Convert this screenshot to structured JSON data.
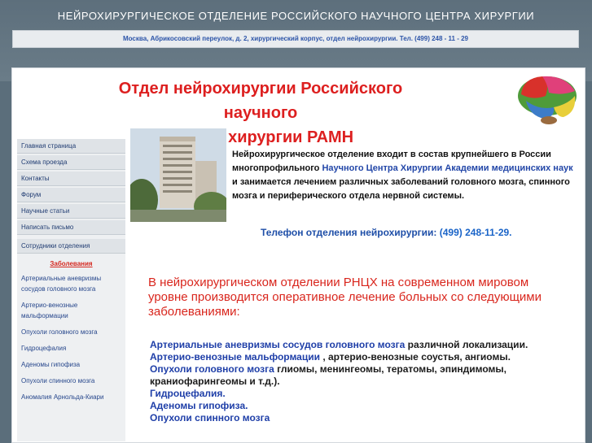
{
  "header": {
    "site_title": "НЕЙРОХИРУРГИЧЕСКОЕ ОТДЕЛЕНИЕ РОССИЙСКОГО НАУЧНОГО ЦЕНТРА ХИРУРГИИ",
    "address": "Москва, Абрикосовский переулок, д. 2, хирургический корпус, отдел нейрохирургии. Тел. (499) 248 - 11 - 29",
    "page_title_line1": "Отдел нейрохирургии Российского научного",
    "page_title_line2": "центра хирургии РАМН"
  },
  "sidebar": {
    "items": [
      {
        "label": "Главная страница"
      },
      {
        "label": "Схема проезда"
      },
      {
        "label": "Контакты"
      },
      {
        "label": "Форум"
      },
      {
        "label": "Научные статьи"
      },
      {
        "label": "Написать письмо"
      }
    ],
    "staff_label": "Сотрудники отделения",
    "diseases_title": "Заболевания",
    "diseases": [
      {
        "label": "Артериальные аневризмы сосудов головного мозга"
      },
      {
        "label": "Артерио-венозные мальформации"
      },
      {
        "label": "Опухоли головного мозга"
      },
      {
        "label": "Гидроцефалия"
      },
      {
        "label": "Аденомы гипофиза"
      },
      {
        "label": "Опухоли спинного мозга"
      },
      {
        "label": "Аномалия Арнольда-Киари"
      }
    ]
  },
  "intro": {
    "text_before": "Нейрохирургическое отделение входит в состав крупнейшего в России многопрофильного ",
    "link_text": "Научного Центра Хирургии Академии медицинских наук",
    "text_after": " и занимается лечением различных заболеваний головного мозга, спинного мозга и периферического отдела нервной системы."
  },
  "phone": {
    "label": "Телефон отделения нейрохирургии:",
    "number": "(499) 248-11-29."
  },
  "lead": "В нейрохирургическом отделении РНЦХ на современном мировом уровне производится оперативное лечение больных со следующими заболеваниями:",
  "disease_list": [
    {
      "name": "Артериальные аневризмы сосудов головного мозга",
      "desc": "различной локализации."
    },
    {
      "name": "Артерио-венозные мальформации",
      "desc": ", артерио-венозные соустья, ангиомы."
    },
    {
      "name": "Опухоли головного мозга",
      "desc": "глиомы, менингеомы, тератомы, эпиндимомы, краниофарингеомы и т.д.)."
    },
    {
      "name": "Гидроцефалия.",
      "desc": ""
    },
    {
      "name": "Аденомы гипофиза.",
      "desc": ""
    },
    {
      "name": "Опухоли спинного мозга",
      "desc": ""
    }
  ],
  "colors": {
    "background": "#5b6e7b",
    "title_red": "#dd1f1f",
    "link_blue": "#2347a8",
    "sidebar_bg": "#dfe3e7"
  }
}
